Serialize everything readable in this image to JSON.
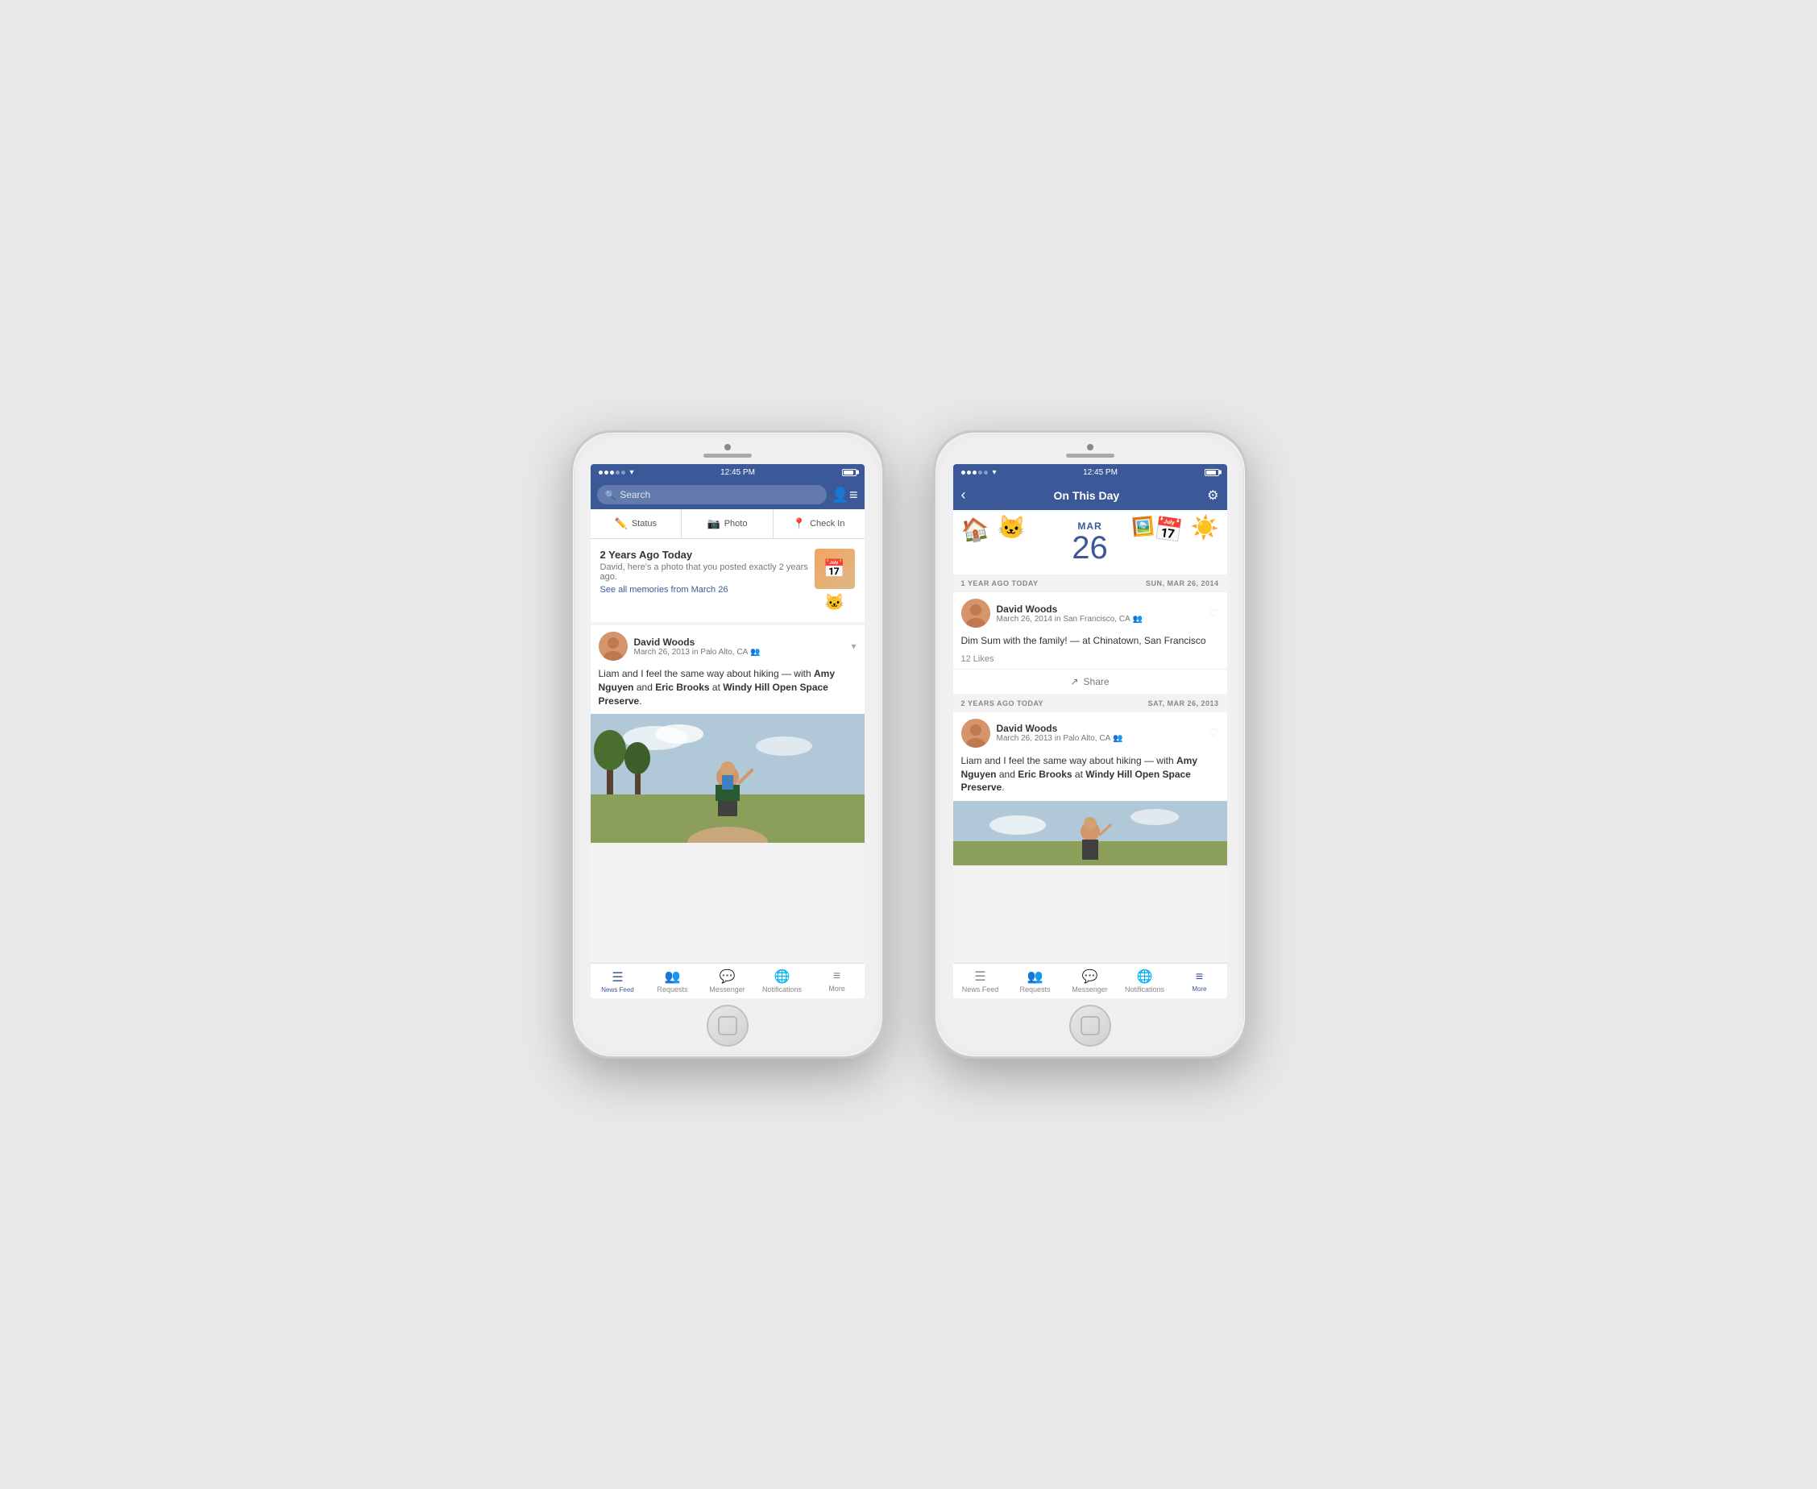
{
  "phone1": {
    "status_bar": {
      "time": "12:45 PM",
      "signal": "●●●○○",
      "carrier": "○",
      "wifi": "▾",
      "battery": "battery"
    },
    "search": {
      "placeholder": "Search"
    },
    "actions": [
      {
        "icon": "✏️",
        "label": "Status"
      },
      {
        "icon": "📷",
        "label": "Photo"
      },
      {
        "icon": "📍",
        "label": "Check In"
      }
    ],
    "memory_card": {
      "title": "2 Years Ago Today",
      "description": "David, here's a photo that you posted exactly 2 years ago.",
      "link": "See all memories from March 26"
    },
    "post": {
      "name": "David Woods",
      "date": "March 26, 2013 in Palo Alto, CA",
      "body": "Liam and I feel the same way about hiking — with Amy Nguyen and Eric Brooks at Windy Hill Open Space Preserve."
    },
    "bottom_nav": [
      {
        "icon": "☰",
        "label": "News Feed",
        "active": true
      },
      {
        "icon": "👥",
        "label": "Requests",
        "active": false
      },
      {
        "icon": "💬",
        "label": "Messenger",
        "active": false
      },
      {
        "icon": "🌐",
        "label": "Notifications",
        "active": false
      },
      {
        "icon": "≡",
        "label": "More",
        "active": false
      }
    ]
  },
  "phone2": {
    "status_bar": {
      "time": "12:45 PM"
    },
    "navbar": {
      "title": "On This Day"
    },
    "date": {
      "month": "MAR",
      "day": "26"
    },
    "sections": [
      {
        "header_left": "1 YEAR AGO TODAY",
        "header_right": "Sun, Mar 26, 2014",
        "post": {
          "name": "David Woods",
          "date": "March 26, 2014 in San Francisco, CA",
          "body": "Dim Sum with the family! — at Chinatown, San Francisco",
          "likes": "12 Likes",
          "share_label": "Share"
        }
      },
      {
        "header_left": "2 YEARS AGO TODAY",
        "header_right": "Sat, Mar 26, 2013",
        "post": {
          "name": "David Woods",
          "date": "March 26, 2013 in Palo Alto, CA",
          "body": "Liam and I feel the same way about hiking — with Amy Nguyen and Eric Brooks at Windy Hill Open Space Preserve.",
          "likes": "",
          "share_label": ""
        }
      }
    ],
    "bottom_nav": [
      {
        "icon": "☰",
        "label": "News Feed",
        "active": false
      },
      {
        "icon": "👥",
        "label": "Requests",
        "active": false
      },
      {
        "icon": "💬",
        "label": "Messenger",
        "active": false
      },
      {
        "icon": "🌐",
        "label": "Notifications",
        "active": false
      },
      {
        "icon": "≡",
        "label": "More",
        "active": true
      }
    ]
  }
}
